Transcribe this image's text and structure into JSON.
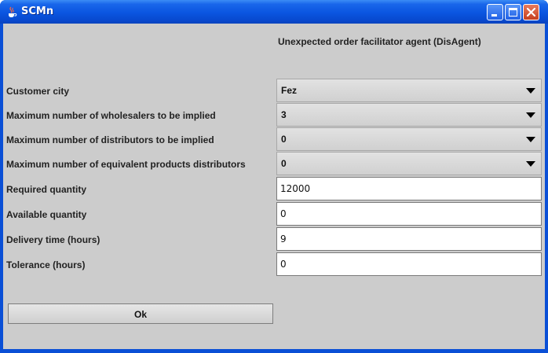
{
  "window": {
    "title": "SCMn",
    "app_icon": "java-cup-icon",
    "controls": [
      "minimize-icon",
      "maximize-icon",
      "close-icon"
    ],
    "titlebar_color": "#0a55e0",
    "close_color": "#c6401f"
  },
  "form": {
    "header": "Unexpected order facilitator agent (DisAgent)",
    "fields": [
      {
        "label": "Customer city",
        "type": "select",
        "value": "Fez"
      },
      {
        "label": "Maximum number of wholesalers to be implied",
        "type": "select",
        "value": "3"
      },
      {
        "label": "Maximum number of distributors to be implied",
        "type": "select",
        "value": "0"
      },
      {
        "label": "Maximum number of equivalent products distributors",
        "type": "select",
        "value": "0"
      },
      {
        "label": "Required quantity",
        "type": "text",
        "value": "12000"
      },
      {
        "label": "Available quantity",
        "type": "text",
        "value": "0"
      },
      {
        "label": "Delivery time (hours)",
        "type": "text",
        "value": "9"
      },
      {
        "label": "Tolerance (hours)",
        "type": "text",
        "value": "0"
      }
    ],
    "ok_label": "Ok"
  }
}
